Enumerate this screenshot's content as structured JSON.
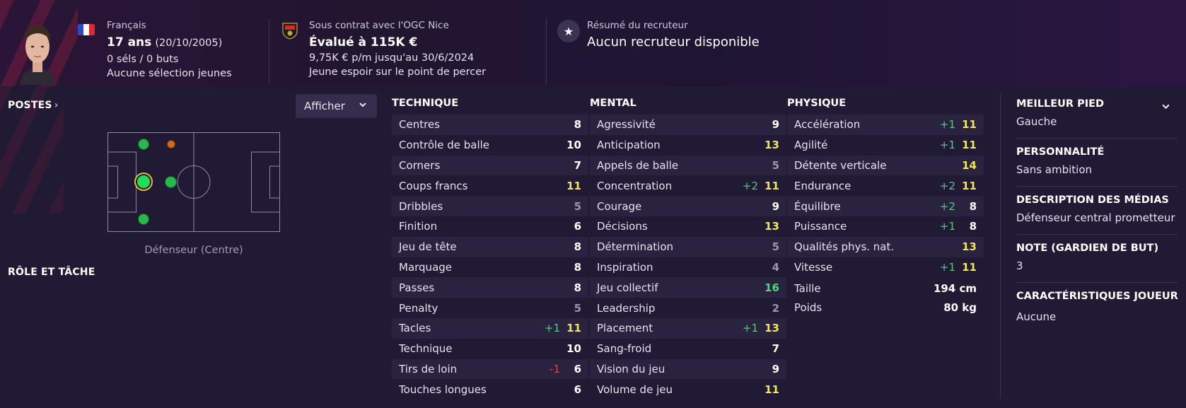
{
  "header": {
    "nationality": "Français",
    "age": "17 ans",
    "dob": "(20/10/2005)",
    "caps": "0 séls / 0 buts",
    "youth_caps": "Aucune sélection jeunes",
    "contract": "Sous contrat avec l'OGC Nice",
    "value": "Évalué à 115K €",
    "wage": "9,75K € p/m jusqu'au 30/6/2024",
    "status": "Jeune espoir sur le point de percer",
    "scout_title": "Résumé du recruteur",
    "scout_text": "Aucun recruteur disponible"
  },
  "positions": {
    "title": "POSTES",
    "title_arrow": "›",
    "show_button": "Afficher",
    "position_label": "Défenseur (Centre)",
    "role_title": "RÔLE ET TÂCHE"
  },
  "technique": {
    "title": "TECHNIQUE",
    "rows": [
      {
        "label": "Centres",
        "value": "8",
        "diff": "",
        "tier": "white"
      },
      {
        "label": "Contrôle de balle",
        "value": "10",
        "diff": "",
        "tier": "white"
      },
      {
        "label": "Corners",
        "value": "7",
        "diff": "",
        "tier": "white"
      },
      {
        "label": "Coups francs",
        "value": "11",
        "diff": "",
        "tier": "yellow"
      },
      {
        "label": "Dribbles",
        "value": "5",
        "diff": "",
        "tier": "grey"
      },
      {
        "label": "Finition",
        "value": "6",
        "diff": "",
        "tier": "white"
      },
      {
        "label": "Jeu de tête",
        "value": "8",
        "diff": "",
        "tier": "white"
      },
      {
        "label": "Marquage",
        "value": "8",
        "diff": "",
        "tier": "white"
      },
      {
        "label": "Passes",
        "value": "8",
        "diff": "",
        "tier": "white"
      },
      {
        "label": "Penalty",
        "value": "5",
        "diff": "",
        "tier": "grey"
      },
      {
        "label": "Tacles",
        "value": "11",
        "diff": "+1",
        "tier": "yellow"
      },
      {
        "label": "Technique",
        "value": "10",
        "diff": "",
        "tier": "white"
      },
      {
        "label": "Tirs de loin",
        "value": "6",
        "diff": "-1",
        "tier": "white"
      },
      {
        "label": "Touches longues",
        "value": "6",
        "diff": "",
        "tier": "white"
      }
    ]
  },
  "mental": {
    "title": "MENTAL",
    "rows": [
      {
        "label": "Agressivité",
        "value": "9",
        "diff": "",
        "tier": "white"
      },
      {
        "label": "Anticipation",
        "value": "13",
        "diff": "",
        "tier": "yellow"
      },
      {
        "label": "Appels de balle",
        "value": "5",
        "diff": "",
        "tier": "grey"
      },
      {
        "label": "Concentration",
        "value": "11",
        "diff": "+2",
        "tier": "yellow"
      },
      {
        "label": "Courage",
        "value": "9",
        "diff": "",
        "tier": "white"
      },
      {
        "label": "Décisions",
        "value": "13",
        "diff": "",
        "tier": "yellow"
      },
      {
        "label": "Détermination",
        "value": "5",
        "diff": "",
        "tier": "grey"
      },
      {
        "label": "Inspiration",
        "value": "4",
        "diff": "",
        "tier": "grey"
      },
      {
        "label": "Jeu collectif",
        "value": "16",
        "diff": "",
        "tier": "green"
      },
      {
        "label": "Leadership",
        "value": "2",
        "diff": "",
        "tier": "grey"
      },
      {
        "label": "Placement",
        "value": "13",
        "diff": "+1",
        "tier": "yellow"
      },
      {
        "label": "Sang-froid",
        "value": "7",
        "diff": "",
        "tier": "white"
      },
      {
        "label": "Vision du jeu",
        "value": "9",
        "diff": "",
        "tier": "white"
      },
      {
        "label": "Volume de jeu",
        "value": "11",
        "diff": "",
        "tier": "yellow"
      }
    ]
  },
  "physique": {
    "title": "PHYSIQUE",
    "rows": [
      {
        "label": "Accélération",
        "value": "11",
        "diff": "+1",
        "tier": "yellow"
      },
      {
        "label": "Agilité",
        "value": "11",
        "diff": "+1",
        "tier": "yellow"
      },
      {
        "label": "Détente verticale",
        "value": "14",
        "diff": "",
        "tier": "yellow"
      },
      {
        "label": "Endurance",
        "value": "11",
        "diff": "+2",
        "tier": "yellow"
      },
      {
        "label": "Équilibre",
        "value": "8",
        "diff": "+2",
        "tier": "white"
      },
      {
        "label": "Puissance",
        "value": "8",
        "diff": "+1",
        "tier": "white"
      },
      {
        "label": "Qualités phys. nat.",
        "value": "13",
        "diff": "",
        "tier": "yellow"
      },
      {
        "label": "Vitesse",
        "value": "11",
        "diff": "+1",
        "tier": "yellow"
      }
    ],
    "height_label": "Taille",
    "height_value": "194 cm",
    "weight_label": "Poids",
    "weight_value": "80 kg"
  },
  "info": {
    "foot_title": "MEILLEUR PIED",
    "foot_value": "Gauche",
    "personality_title": "PERSONNALITÉ",
    "personality_value": "Sans ambition",
    "media_title": "DESCRIPTION DES MÉDIAS",
    "media_value": "Défenseur central prometteur",
    "gk_title": "NOTE (GARDIEN DE BUT)",
    "gk_value": "3",
    "traits_title": "CARACTÉRISTIQUES JOUEUR",
    "traits_value": "Aucune"
  },
  "colors": {
    "attr_white": "#ffffff",
    "attr_grey": "#9a95a8",
    "attr_yellow": "#f1e55a",
    "attr_green": "#4fdd7c",
    "diff_positive": "#5cc584",
    "diff_negative": "#ff3a3a",
    "position_natural": "#22dd55",
    "position_accomplished": "#2ab84a",
    "position_unconvincing": "#d26a1a"
  },
  "icons": {
    "flag": "france-flag-icon",
    "club": "ogc-nice-badge-icon",
    "scout": "star-icon",
    "dropdown": "chevron-down-icon"
  }
}
